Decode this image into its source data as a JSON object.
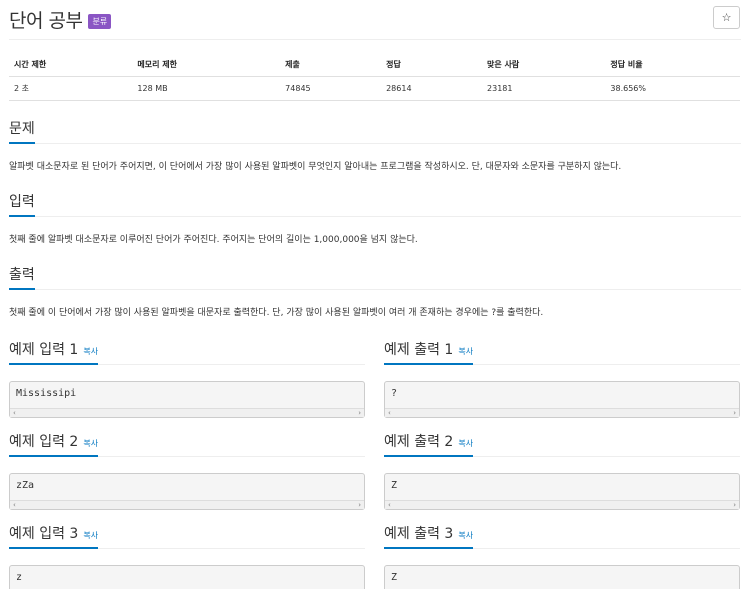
{
  "header": {
    "title": "단어 공부",
    "tag": "분류",
    "star": "☆"
  },
  "stats": {
    "headers": [
      "시간 제한",
      "메모리 제한",
      "제출",
      "정답",
      "맞은 사람",
      "정답 비율"
    ],
    "values": [
      "2 초",
      "128 MB",
      "74845",
      "28614",
      "23181",
      "38.656%"
    ]
  },
  "problem": {
    "title": "문제",
    "body": "알파벳 대소문자로 된 단어가 주어지면, 이 단어에서 가장 많이 사용된 알파벳이 무엇인지 알아내는 프로그램을 작성하시오. 단, 대문자와 소문자를 구분하지 않는다."
  },
  "input": {
    "title": "입력",
    "body": "첫째 줄에 알파벳 대소문자로 이루어진 단어가 주어진다. 주어지는 단어의 길이는 1,000,000을 넘지 않는다."
  },
  "output": {
    "title": "출력",
    "body": "첫째 줄에 이 단어에서 가장 많이 사용된 알파벳을 대문자로 출력한다. 단, 가장 많이 사용된 알파벳이 여러 개 존재하는 경우에는 ?를 출력한다."
  },
  "copy_label": "복사",
  "examples": [
    {
      "in_title": "예제 입력 1",
      "in_value": "Mississipi",
      "out_title": "예제 출력 1",
      "out_value": "?"
    },
    {
      "in_title": "예제 입력 2",
      "in_value": "zZa",
      "out_title": "예제 출력 2",
      "out_value": "Z"
    },
    {
      "in_title": "예제 입력 3",
      "in_value": "z",
      "out_title": "예제 출력 3",
      "out_value": "Z"
    }
  ],
  "scroll": {
    "left": "‹",
    "right": "›"
  }
}
